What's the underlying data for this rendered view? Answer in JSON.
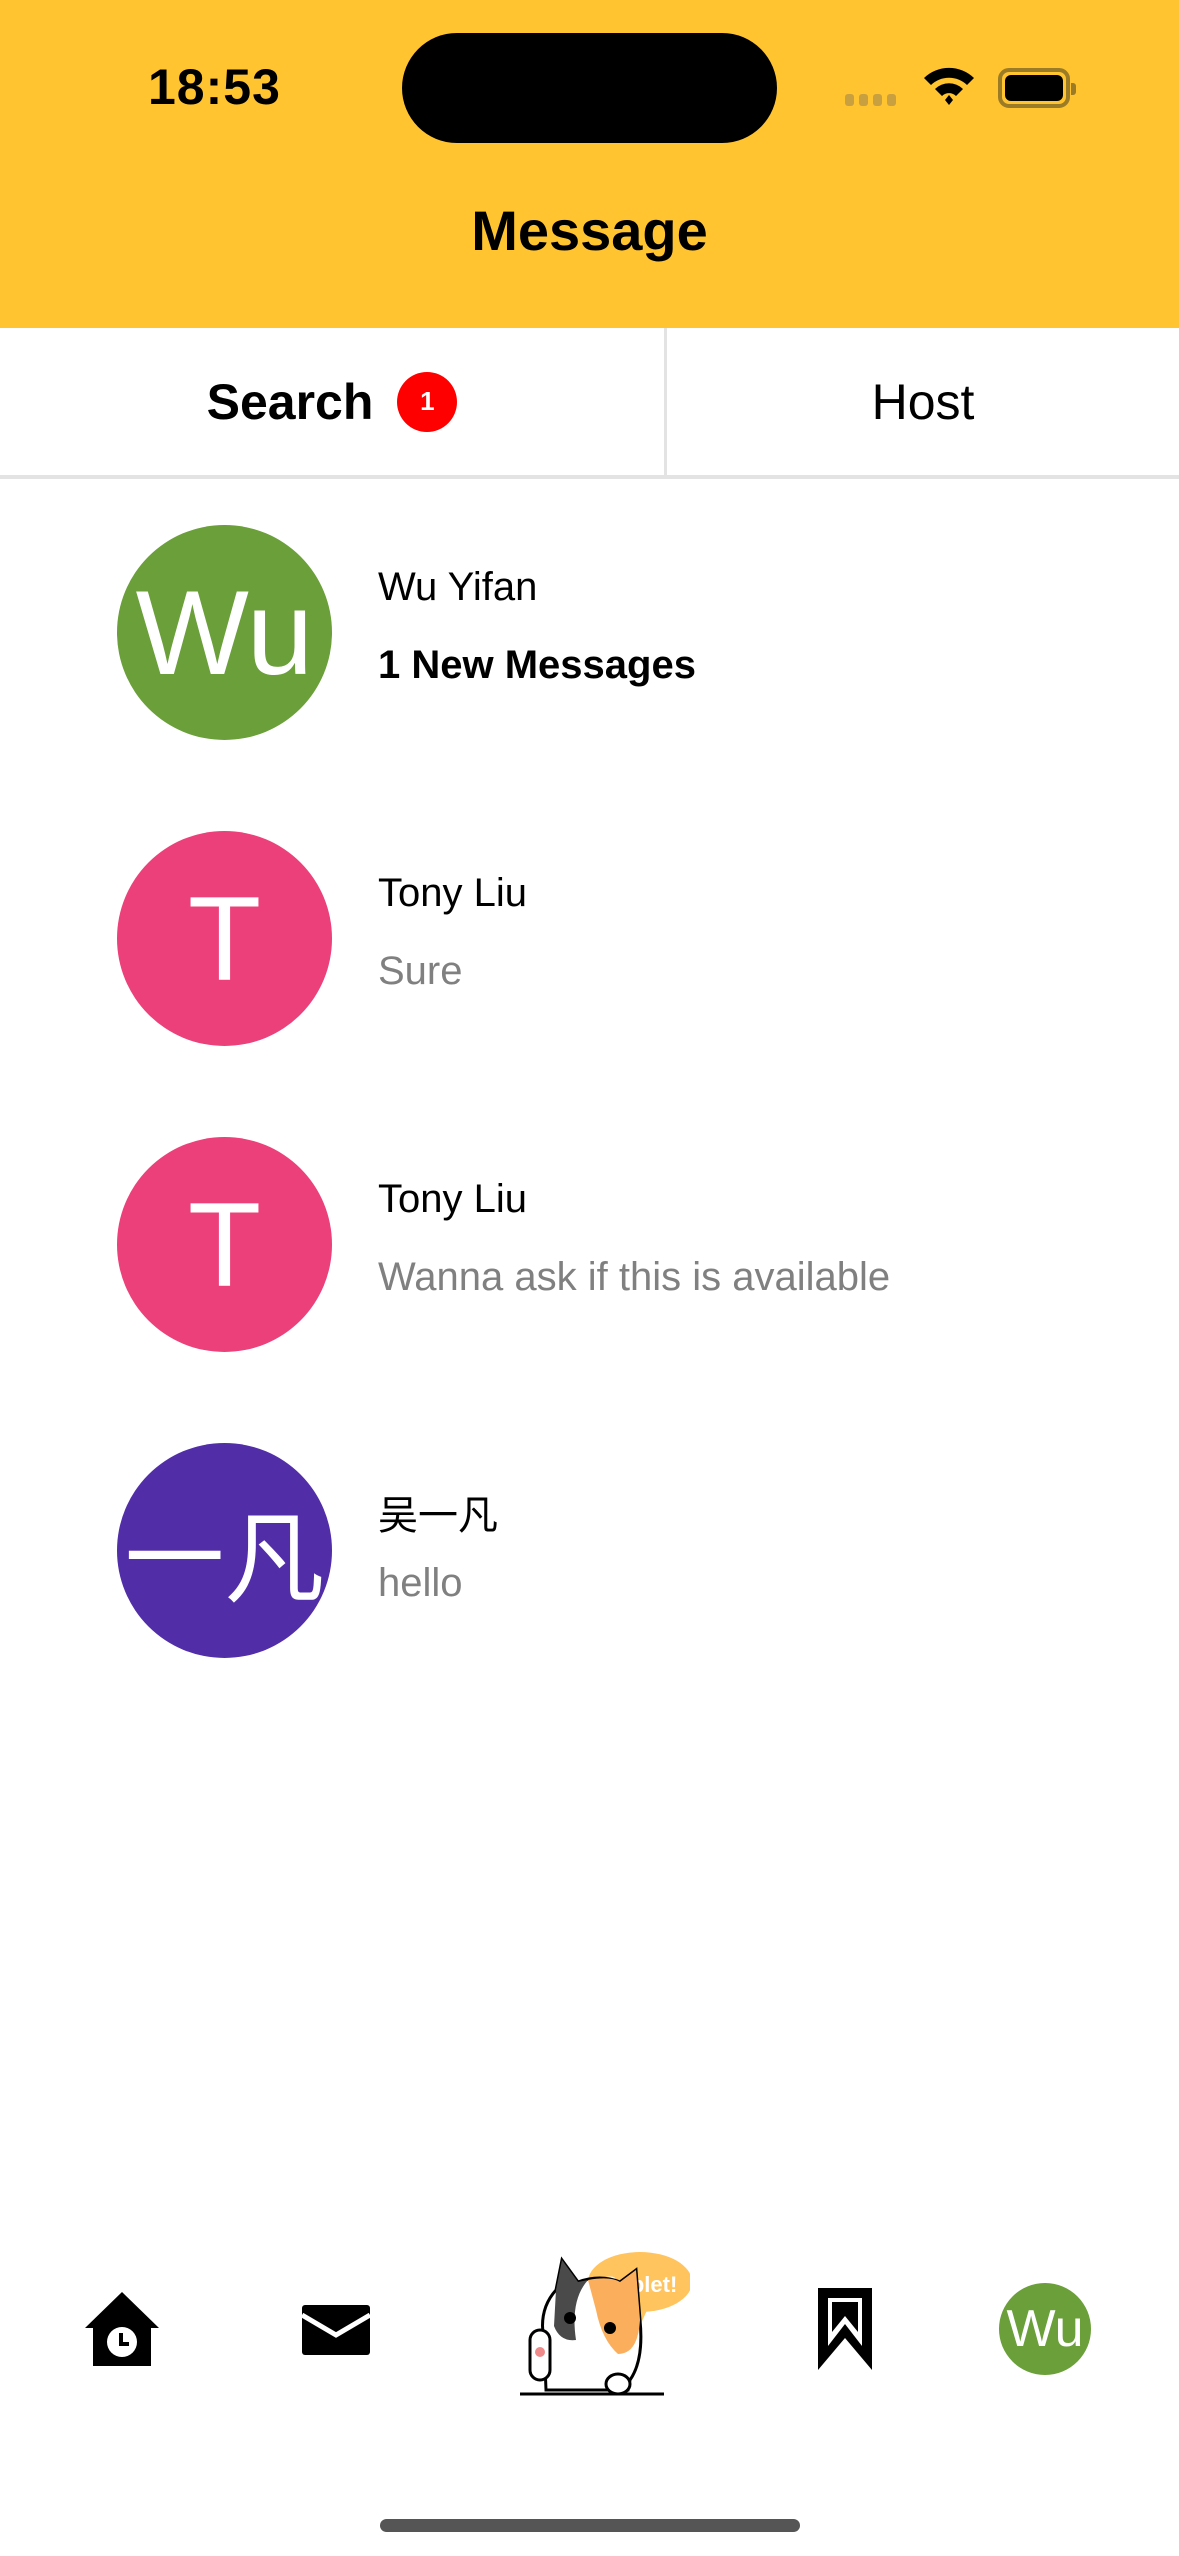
{
  "status_bar": {
    "time": "18:53"
  },
  "header": {
    "title": "Message",
    "background": "#FFC430"
  },
  "tabs": [
    {
      "label": "Search",
      "badge": "1",
      "active": true
    },
    {
      "label": "Host",
      "active": false
    }
  ],
  "conversations": [
    {
      "avatar_text": "Wu",
      "avatar_color": "#6A9F3A",
      "name": "Wu Yifan",
      "preview": "1 New Messages",
      "unread": true
    },
    {
      "avatar_text": "T",
      "avatar_color": "#EC407A",
      "name": "Tony Liu",
      "preview": "Sure",
      "unread": false
    },
    {
      "avatar_text": "T",
      "avatar_color": "#EC407A",
      "name": "Tony Liu",
      "preview": "Wanna ask if this is available",
      "unread": false
    },
    {
      "avatar_text": "一凡",
      "avatar_color": "#512DA8",
      "name": "吴一凡",
      "preview": "hello",
      "unread": false
    }
  ],
  "bottom_nav": {
    "items": [
      "home-icon",
      "mail-icon",
      "sublet-cat-logo",
      "bookmark-icon",
      "profile-avatar"
    ],
    "logo_bubble": "Sublet!",
    "profile_text": "Wu"
  }
}
